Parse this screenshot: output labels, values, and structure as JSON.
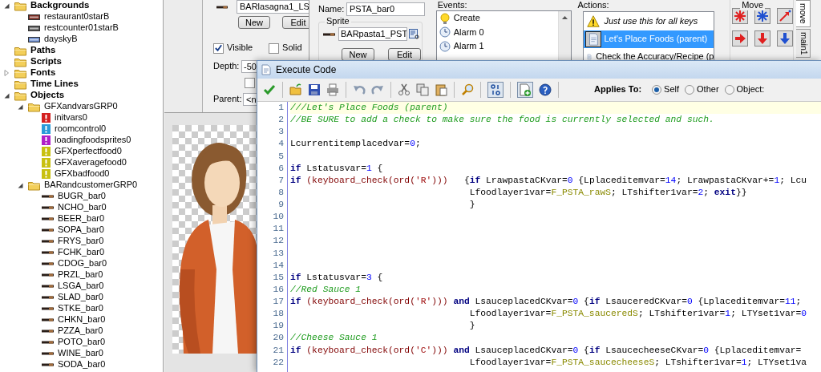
{
  "tree": [
    {
      "label": "Backgrounds",
      "kind": "folder",
      "expanded": true,
      "children": [
        {
          "label": "restaurant0starB",
          "kind": "background",
          "color": "#7a2a20"
        },
        {
          "label": "restcounter01starB",
          "kind": "background",
          "color": "#555555"
        },
        {
          "label": "dayskyB",
          "kind": "background",
          "color": "#6688cc"
        }
      ]
    },
    {
      "label": "Paths",
      "kind": "folder"
    },
    {
      "label": "Scripts",
      "kind": "folder"
    },
    {
      "label": "Fonts",
      "kind": "folder",
      "expanded": false
    },
    {
      "label": "Time Lines",
      "kind": "folder"
    },
    {
      "label": "Objects",
      "kind": "folder",
      "expanded": true,
      "children": [
        {
          "label": "GFXandvarsGRP0",
          "kind": "group",
          "expanded": true,
          "children": [
            {
              "label": "initvars0",
              "kind": "object",
              "color": "#d42020"
            },
            {
              "label": "roomcontrol0",
              "kind": "object",
              "color": "#2a9ad8"
            },
            {
              "label": "loadingfoodsprites0",
              "kind": "object",
              "color": "#b020c8"
            },
            {
              "label": "GFXperfectfood0",
              "kind": "object",
              "color": "#c8c010"
            },
            {
              "label": "GFXaveragefood0",
              "kind": "object",
              "color": "#c8c010"
            },
            {
              "label": "GFXbadfood0",
              "kind": "object",
              "color": "#c8c010"
            }
          ]
        },
        {
          "label": "BARandcustomerGRP0",
          "kind": "group",
          "expanded": true,
          "children": [
            {
              "label": "BUGR_bar0",
              "kind": "sprite"
            },
            {
              "label": "NCHO_bar0",
              "kind": "sprite"
            },
            {
              "label": "BEER_bar0",
              "kind": "sprite"
            },
            {
              "label": "SOPA_bar0",
              "kind": "sprite"
            },
            {
              "label": "FRYS_bar0",
              "kind": "sprite"
            },
            {
              "label": "FCHK_bar0",
              "kind": "sprite"
            },
            {
              "label": "CDOG_bar0",
              "kind": "sprite"
            },
            {
              "label": "PRZL_bar0",
              "kind": "sprite"
            },
            {
              "label": "LSGA_bar0",
              "kind": "sprite"
            },
            {
              "label": "SLAD_bar0",
              "kind": "sprite"
            },
            {
              "label": "STKE_bar0",
              "kind": "sprite"
            },
            {
              "label": "CHKN_bar0",
              "kind": "sprite"
            },
            {
              "label": "PZZA_bar0",
              "kind": "sprite"
            },
            {
              "label": "POTO_bar0",
              "kind": "sprite"
            },
            {
              "label": "WINE_bar0",
              "kind": "sprite"
            },
            {
              "label": "SODA_bar0",
              "kind": "sprite"
            }
          ]
        }
      ]
    }
  ],
  "back_window": {
    "sprite_field": "BARlasagna1_LS",
    "buttons": [
      "New",
      "Edit"
    ],
    "checkboxes": [
      {
        "label": "Visible",
        "checked": true
      },
      {
        "label": "Solid",
        "checked": false
      }
    ],
    "depth_label": "Depth:",
    "depth_value": "-50",
    "extra_checkbox": {
      "checked": false
    },
    "parent_label": "Parent:",
    "parent_value": "<n"
  },
  "object_window": {
    "name_label": "Name:",
    "name_value": "PSTA_bar0",
    "sprite_group": "Sprite",
    "sprite_field": "BARpasta1_PST",
    "buttons": [
      "New",
      "Edit"
    ],
    "events_label": "Events:",
    "events": [
      {
        "label": "Create",
        "kind": "create"
      },
      {
        "label": "Alarm 0",
        "kind": "alarm"
      },
      {
        "label": "Alarm 1",
        "kind": "alarm"
      }
    ],
    "actions_label": "Actions:",
    "actions": [
      {
        "label": "Just use this for all keys",
        "kind": "comment",
        "selected": false
      },
      {
        "label": "Let's Place Foods (parent)",
        "kind": "code",
        "selected": true
      },
      {
        "label": "Check the Accuracy/Recipe (p",
        "kind": "code",
        "selected": false
      }
    ]
  },
  "palette": {
    "group": "Move",
    "tabs": [
      {
        "label": "move",
        "selected": true
      },
      {
        "label": "main1",
        "selected": false
      }
    ]
  },
  "code_window": {
    "title": "Execute Code",
    "applies_label": "Applies To:",
    "applies_options": [
      {
        "label": "Self",
        "selected": true
      },
      {
        "label": "Other",
        "selected": false
      },
      {
        "label": "Object:",
        "selected": false
      }
    ],
    "lines": [
      {
        "number": "1",
        "current": true,
        "tokens": [
          {
            "kind": "comment",
            "text": "///Let's Place Foods (parent)"
          }
        ]
      },
      {
        "number": "2",
        "current": false,
        "tokens": [
          {
            "kind": "comment",
            "text": "//BE SURE to add a check to make sure the food is currently selected and such."
          }
        ]
      },
      {
        "number": "3",
        "current": false
      },
      {
        "number": "4",
        "current": false,
        "tokens": [
          {
            "kind": "plain",
            "text": "Lcurrentitemplacedvar="
          },
          {
            "kind": "number",
            "text": "0"
          },
          {
            "kind": "plain",
            "text": ";"
          }
        ]
      },
      {
        "number": "5",
        "current": false
      },
      {
        "number": "6",
        "current": false,
        "tokens": [
          {
            "kind": "keyword",
            "text": "if"
          },
          {
            "kind": "plain",
            "text": " Lstatusvar="
          },
          {
            "kind": "number",
            "text": "1"
          },
          {
            "kind": "plain",
            "text": " {"
          }
        ]
      },
      {
        "number": "7",
        "current": false,
        "tokens": [
          {
            "kind": "keyword",
            "text": "if"
          },
          {
            "kind": "function",
            "text": " (keyboard_check(ord("
          },
          {
            "kind": "string",
            "text": "'R'"
          },
          {
            "kind": "function",
            "text": ")))"
          },
          {
            "kind": "plain",
            "text": "   {"
          },
          {
            "kind": "keyword",
            "text": "if"
          },
          {
            "kind": "plain",
            "text": " LrawpastaCKvar="
          },
          {
            "kind": "number",
            "text": "0"
          },
          {
            "kind": "plain",
            "text": " {Lplaceditemvar="
          },
          {
            "kind": "number",
            "text": "14"
          },
          {
            "kind": "plain",
            "text": "; LrawpastaCKvar+="
          },
          {
            "kind": "number",
            "text": "1"
          },
          {
            "kind": "plain",
            "text": "; Lcu"
          }
        ]
      },
      {
        "number": "8",
        "current": false,
        "tokens": [
          {
            "kind": "plain",
            "text": "                                 Lfoodlayer1var="
          },
          {
            "kind": "constant",
            "text": "F_PSTA_rawS"
          },
          {
            "kind": "plain",
            "text": "; LTshifter1var="
          },
          {
            "kind": "number",
            "text": "2"
          },
          {
            "kind": "plain",
            "text": "; "
          },
          {
            "kind": "keyword",
            "text": "exit"
          },
          {
            "kind": "plain",
            "text": "}}"
          }
        ]
      },
      {
        "number": "9",
        "current": false,
        "tokens": [
          {
            "kind": "plain",
            "text": "                                 }"
          }
        ]
      },
      {
        "number": "10",
        "current": false
      },
      {
        "number": "11",
        "current": false
      },
      {
        "number": "12",
        "current": false
      },
      {
        "number": "13",
        "current": false
      },
      {
        "number": "14",
        "current": false
      },
      {
        "number": "15",
        "current": false,
        "tokens": [
          {
            "kind": "keyword",
            "text": "if"
          },
          {
            "kind": "plain",
            "text": " Lstatusvar="
          },
          {
            "kind": "number",
            "text": "3"
          },
          {
            "kind": "plain",
            "text": " {"
          }
        ]
      },
      {
        "number": "16",
        "current": false,
        "tokens": [
          {
            "kind": "comment",
            "text": "//Red Sauce 1"
          }
        ]
      },
      {
        "number": "17",
        "current": false,
        "tokens": [
          {
            "kind": "keyword",
            "text": "if"
          },
          {
            "kind": "function",
            "text": " (keyboard_check(ord("
          },
          {
            "kind": "string",
            "text": "'R'"
          },
          {
            "kind": "function",
            "text": "))) "
          },
          {
            "kind": "keyword",
            "text": "and"
          },
          {
            "kind": "plain",
            "text": " LsauceplacedCKvar="
          },
          {
            "kind": "number",
            "text": "0"
          },
          {
            "kind": "plain",
            "text": " {"
          },
          {
            "kind": "keyword",
            "text": "if"
          },
          {
            "kind": "plain",
            "text": " LsauceredCKvar="
          },
          {
            "kind": "number",
            "text": "0"
          },
          {
            "kind": "plain",
            "text": " {Lplaceditemvar="
          },
          {
            "kind": "number",
            "text": "11"
          },
          {
            "kind": "plain",
            "text": ";"
          }
        ]
      },
      {
        "number": "18",
        "current": false,
        "tokens": [
          {
            "kind": "plain",
            "text": "                                 Lfoodlayer1var="
          },
          {
            "kind": "constant",
            "text": "F_PSTA_sauceredS"
          },
          {
            "kind": "plain",
            "text": "; LTshifter1var="
          },
          {
            "kind": "number",
            "text": "1"
          },
          {
            "kind": "plain",
            "text": "; LTYset1var="
          },
          {
            "kind": "number",
            "text": "0"
          }
        ]
      },
      {
        "number": "19",
        "current": false,
        "tokens": [
          {
            "kind": "plain",
            "text": "                                 }"
          }
        ]
      },
      {
        "number": "20",
        "current": false,
        "tokens": [
          {
            "kind": "comment",
            "text": "//Cheese Sauce 1"
          }
        ]
      },
      {
        "number": "21",
        "current": false,
        "tokens": [
          {
            "kind": "keyword",
            "text": "if"
          },
          {
            "kind": "function",
            "text": " (keyboard_check(ord("
          },
          {
            "kind": "string",
            "text": "'C'"
          },
          {
            "kind": "function",
            "text": "))) "
          },
          {
            "kind": "keyword",
            "text": "and"
          },
          {
            "kind": "plain",
            "text": " LsauceplacedCKvar="
          },
          {
            "kind": "number",
            "text": "0"
          },
          {
            "kind": "plain",
            "text": " {"
          },
          {
            "kind": "keyword",
            "text": "if"
          },
          {
            "kind": "plain",
            "text": " LsaucecheeseCKvar="
          },
          {
            "kind": "number",
            "text": "0"
          },
          {
            "kind": "plain",
            "text": " {Lplaceditemvar="
          }
        ]
      },
      {
        "number": "22",
        "current": false,
        "tokens": [
          {
            "kind": "plain",
            "text": "                                 Lfoodlayer1var="
          },
          {
            "kind": "constant",
            "text": "F_PSTA_saucecheeseS"
          },
          {
            "kind": "plain",
            "text": "; LTshifter1var="
          },
          {
            "kind": "number",
            "text": "1"
          },
          {
            "kind": "plain",
            "text": "; LTYset1va"
          }
        ]
      }
    ]
  }
}
